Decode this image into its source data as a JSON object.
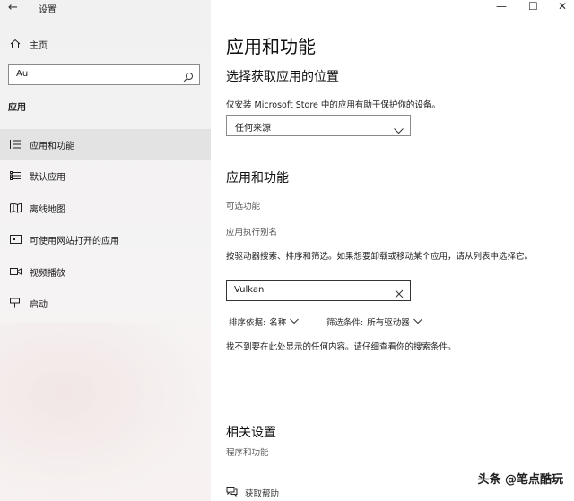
{
  "window": {
    "title": "设置",
    "back_glyph": "←",
    "minimize_glyph": "—",
    "maximize_glyph": "☐",
    "close_glyph": "✕"
  },
  "sidebar": {
    "home_label": "主页",
    "search_value": "Au",
    "section_title": "应用",
    "items": [
      {
        "label": "应用和功能",
        "icon": "list-icon",
        "active": true
      },
      {
        "label": "默认应用",
        "icon": "default-apps-icon",
        "active": false
      },
      {
        "label": "离线地图",
        "icon": "map-icon",
        "active": false
      },
      {
        "label": "可使用网站打开的应用",
        "icon": "website-app-icon",
        "active": false
      },
      {
        "label": "视频播放",
        "icon": "video-icon",
        "active": false
      },
      {
        "label": "启动",
        "icon": "startup-icon",
        "active": false
      }
    ]
  },
  "main": {
    "page_title": "应用和功能",
    "install_section": {
      "heading": "选择获取应用的位置",
      "description": "仅安装 Microsoft Store 中的应用有助于保护你的设备。",
      "dropdown_value": "任何来源"
    },
    "apps_section": {
      "heading": "应用和功能",
      "optional_features_link": "可选功能",
      "app_alias_link": "应用执行别名",
      "instructions": "按驱动器搜索、排序和筛选。如果想要卸载或移动某个应用，请从列表中选择它。",
      "filter_value": "Vulkan",
      "sort_label": "排序依据:",
      "sort_value": "名称",
      "filter_label": "筛选条件:",
      "filter_drive_value": "所有驱动器",
      "no_results": "找不到要在此处显示的任何内容。请仔细查看你的搜索条件。"
    },
    "related": {
      "heading": "相关设置",
      "programs_link": "程序和功能"
    },
    "help_link": "获取帮助"
  },
  "watermark": "头条 @笔点酷玩",
  "colors": {
    "sidebar_bg": "#f1f1f1",
    "active_item_bg": "#e3e3e3",
    "text": "#1a1a1a",
    "link_gray": "#555555"
  }
}
